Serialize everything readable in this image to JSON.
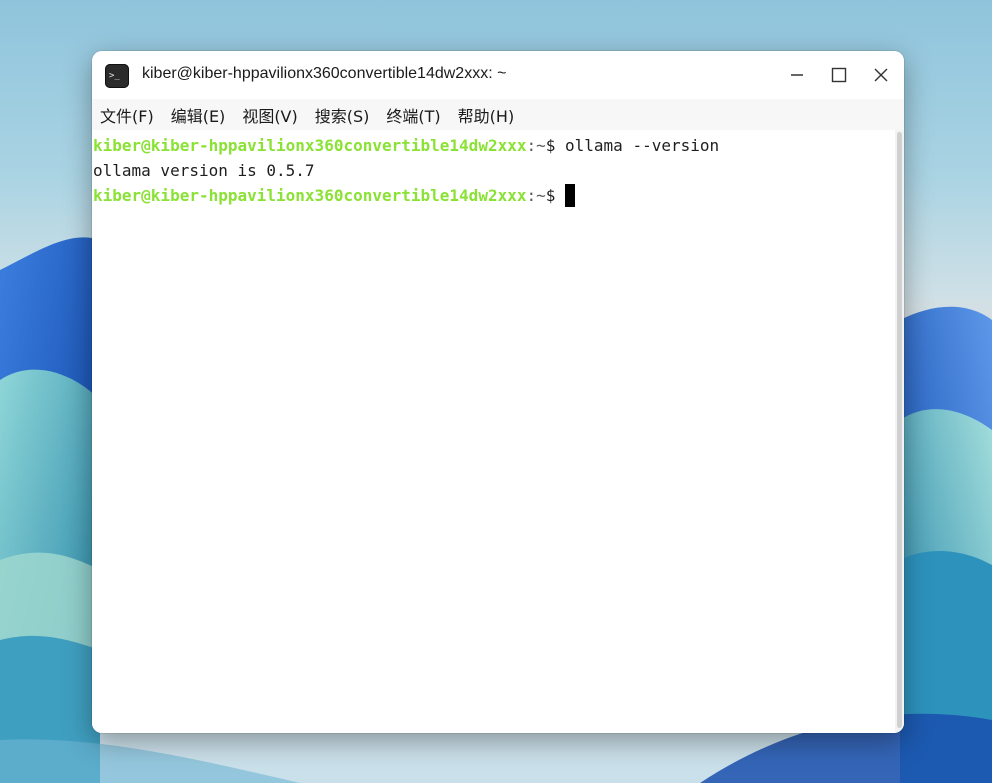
{
  "window": {
    "title": "kiber@kiber-hppavilionx360convertible14dw2xxx: ~",
    "icon": "terminal-icon",
    "icon_glyph": ">_"
  },
  "menubar": {
    "items": [
      {
        "label": "文件(F)"
      },
      {
        "label": "编辑(E)"
      },
      {
        "label": "视图(V)"
      },
      {
        "label": "搜索(S)"
      },
      {
        "label": "终端(T)"
      },
      {
        "label": "帮助(H)"
      }
    ]
  },
  "terminal": {
    "lines": [
      {
        "user_host": "kiber@kiber-hppavilionx360convertible14dw2xxx",
        "path": ":~",
        "symbol": "$ ",
        "command": "ollama --version"
      },
      {
        "output": "ollama version is 0.5.7"
      },
      {
        "user_host": "kiber@kiber-hppavilionx360convertible14dw2xxx",
        "path": ":~",
        "symbol": "$ ",
        "command": ""
      }
    ]
  },
  "colors": {
    "prompt_user": "#8ae234",
    "text": "#1e1e1e",
    "background": "#ffffff"
  }
}
